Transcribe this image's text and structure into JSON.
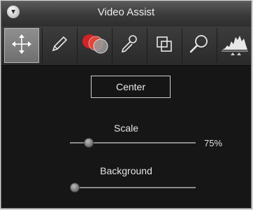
{
  "window": {
    "title": "Video Assist"
  },
  "toolbar": {
    "tools": [
      {
        "icon": "move-arrows-icon",
        "active": true
      },
      {
        "icon": "pencil-icon",
        "active": false
      },
      {
        "icon": "overlapping-circles-icon",
        "active": false
      },
      {
        "icon": "eyedropper-icon",
        "active": false
      },
      {
        "icon": "overlapping-squares-icon",
        "active": false
      },
      {
        "icon": "magnifier-icon",
        "active": false
      },
      {
        "icon": "histogram-icon",
        "active": false
      }
    ]
  },
  "main": {
    "center_label": "Center",
    "scale": {
      "label": "Scale",
      "value_text": "75%",
      "position": 0.15
    },
    "background": {
      "label": "Background",
      "position": 0.03
    }
  },
  "colors": {
    "panel_bg": "#161616",
    "accent_red": "#d0242a",
    "slider_track": "#8a8a8a"
  }
}
